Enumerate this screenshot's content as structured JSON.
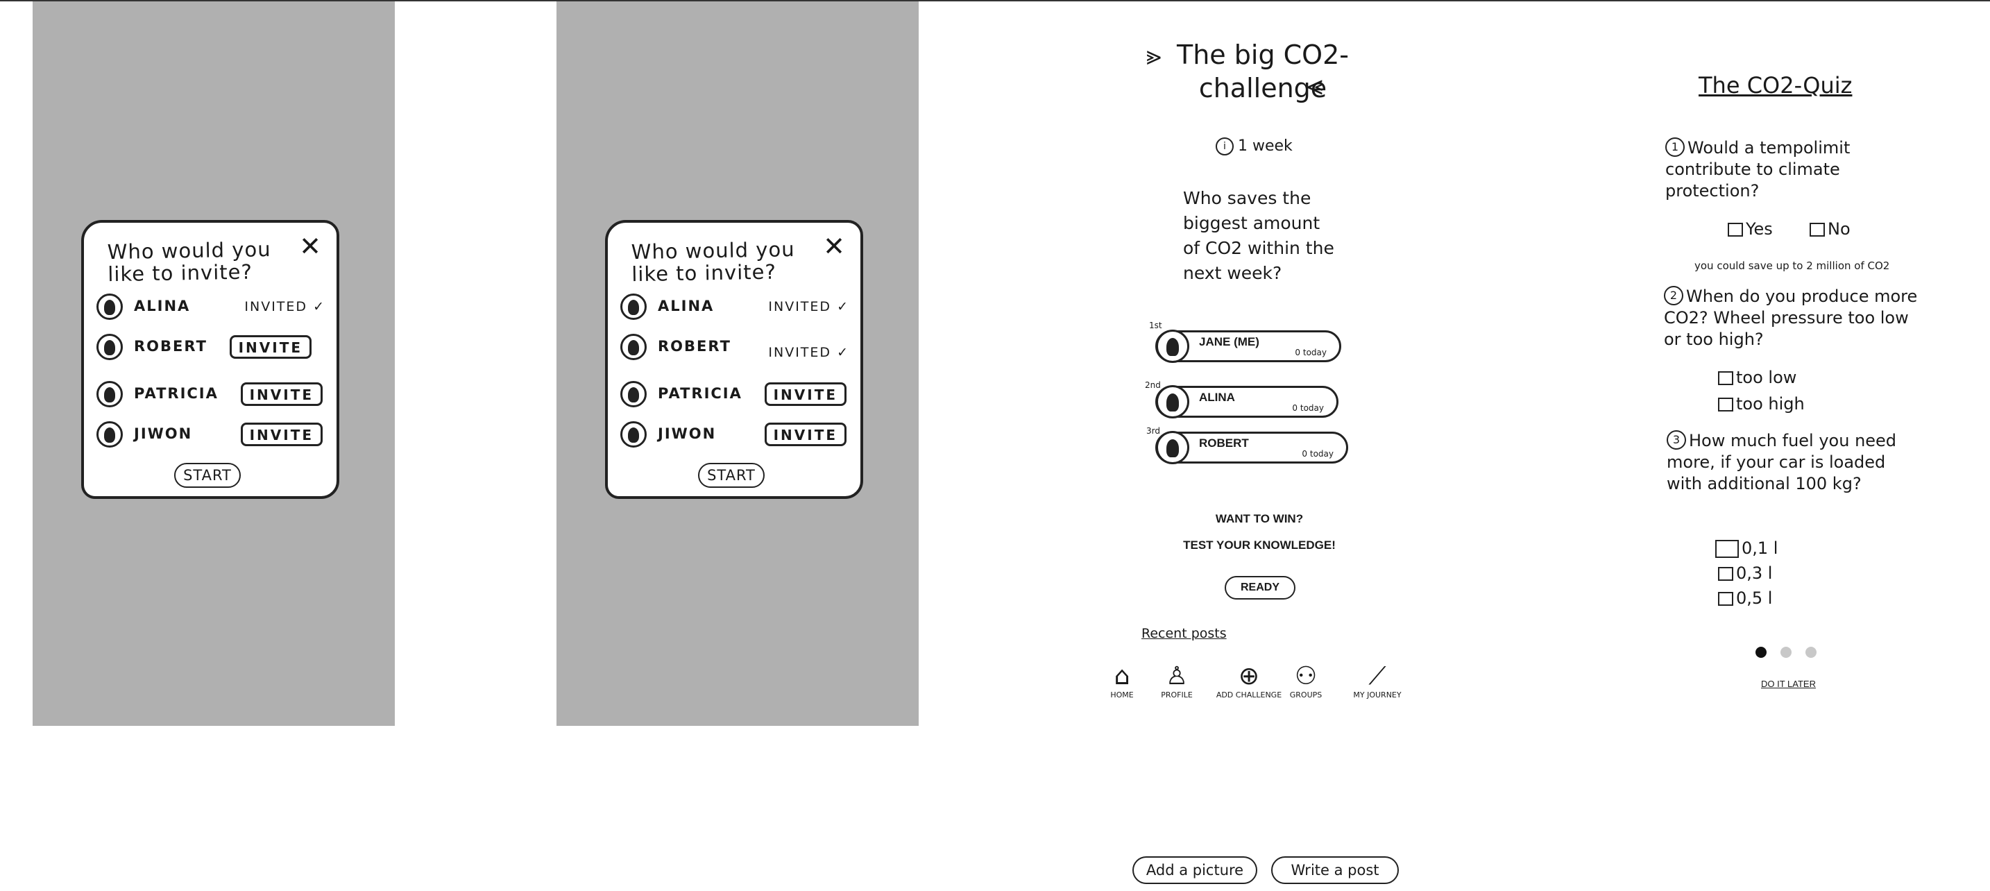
{
  "invite_dialogs": [
    {
      "title": "Who would you like to invite?",
      "close_icon": "✕",
      "start_label": "START",
      "friends": [
        {
          "name": "ALINA",
          "status": "INVITED ✓",
          "invited": true
        },
        {
          "name": "ROBERT",
          "status": "INVITE",
          "invited": false
        },
        {
          "name": "PATRICIA",
          "status": "INVITE",
          "invited": false
        },
        {
          "name": "JIWON",
          "status": "INVITE",
          "invited": false
        }
      ]
    },
    {
      "title": "Who would you like to invite?",
      "close_icon": "✕",
      "start_label": "START",
      "friends": [
        {
          "name": "ALINA",
          "status": "INVITED ✓",
          "invited": true
        },
        {
          "name": "ROBERT",
          "status": "INVITED ✓",
          "invited": true
        },
        {
          "name": "PATRICIA",
          "status": "INVITE",
          "invited": false
        },
        {
          "name": "JIWON",
          "status": "INVITE",
          "invited": false
        }
      ]
    }
  ],
  "challenge": {
    "title": "The big CO2-challenge",
    "arrow_left": "⪢",
    "arrow_right": "⪡",
    "duration": "1 week",
    "clock_icon": "i",
    "question": "Who saves the biggest amount of CO2 within the next week?",
    "leaderboard": [
      {
        "rank": "1st",
        "name": "JANE (ME)",
        "score": "0 today"
      },
      {
        "rank": "2nd",
        "name": "ALINA",
        "score": "0 today"
      },
      {
        "rank": "3rd",
        "name": "ROBERT",
        "score": "0 today"
      }
    ],
    "want_to_win": "WANT TO WIN?",
    "test_knowledge": "TEST YOUR KNOWLEDGE!",
    "ready_label": "READY",
    "recent_posts": "Recent posts",
    "nav": [
      {
        "icon": "⌂",
        "label": "HOME"
      },
      {
        "icon": "♙",
        "label": "PROFILE"
      },
      {
        "icon": "⊕",
        "label": "ADD CHALLENGE"
      },
      {
        "icon": "⚇",
        "label": "GROUPS"
      },
      {
        "icon": "⟋",
        "label": "MY JOURNEY"
      }
    ],
    "add_picture": "Add a picture",
    "write_post": "Write a post"
  },
  "quiz": {
    "title": "The CO2-Quiz",
    "questions": [
      {
        "num": "1",
        "text": "Would a tempolimit contribute to climate protection?",
        "options": [
          "Yes",
          "No"
        ]
      },
      {
        "num": "2",
        "text": "When do you produce more CO2? Wheel pressure too low or too high?",
        "options": [
          "too low",
          "too high"
        ]
      },
      {
        "num": "3",
        "text": "How much fuel you need more, if your car is loaded with additional 100 kg?",
        "options": [
          "0,1 l",
          "0,3 l",
          "0,5 l"
        ]
      }
    ],
    "note": "you could save up to 2 million of CO2",
    "pager": [
      true,
      false,
      false
    ],
    "do_it_later": "DO IT LATER",
    "colors": {
      "dot_active": "#111111",
      "dot_inactive": "#c8c8c8",
      "panel_gray": "#b0b0b0"
    }
  }
}
